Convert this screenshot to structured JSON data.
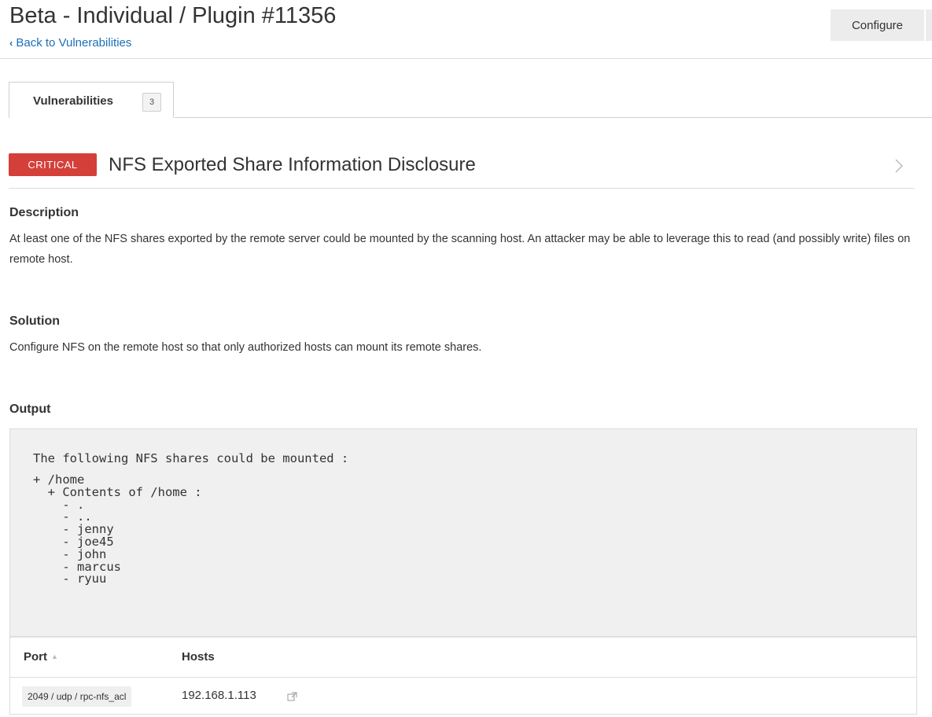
{
  "header": {
    "title": "Beta - Individual / Plugin #11356",
    "back_chevron": "‹",
    "back_label": "Back to Vulnerabilities",
    "configure_label": "Configure"
  },
  "tabs": [
    {
      "label": "Vulnerabilities",
      "count": "3"
    }
  ],
  "vulnerability": {
    "severity": "CRITICAL",
    "severity_color": "#d43f3a",
    "title": "NFS Exported Share Information Disclosure",
    "next_icon": "chevron-right-icon"
  },
  "sections": {
    "description_heading": "Description",
    "description_text": "At least one of the NFS shares exported by the remote server could be mounted by the scanning host. An attacker may be able to leverage this to read (and possibly write) files on remote host.",
    "solution_heading": "Solution",
    "solution_text": "Configure NFS on the remote host so that only authorized hosts can mount its remote shares.",
    "output_heading": "Output"
  },
  "output": {
    "line1": "The following NFS shares could be mounted :",
    "rest": "+ /home\n  + Contents of /home :\n    - .\n    - ..\n    - jenny\n    - joe45\n    - john\n    - marcus\n    - ryuu"
  },
  "hosts_table": {
    "col_port": "Port",
    "col_hosts": "Hosts",
    "sort_icon": "▲",
    "rows": [
      {
        "port": "2049 / udp / rpc-nfs_acl",
        "host": "192.168.1.113"
      }
    ]
  }
}
